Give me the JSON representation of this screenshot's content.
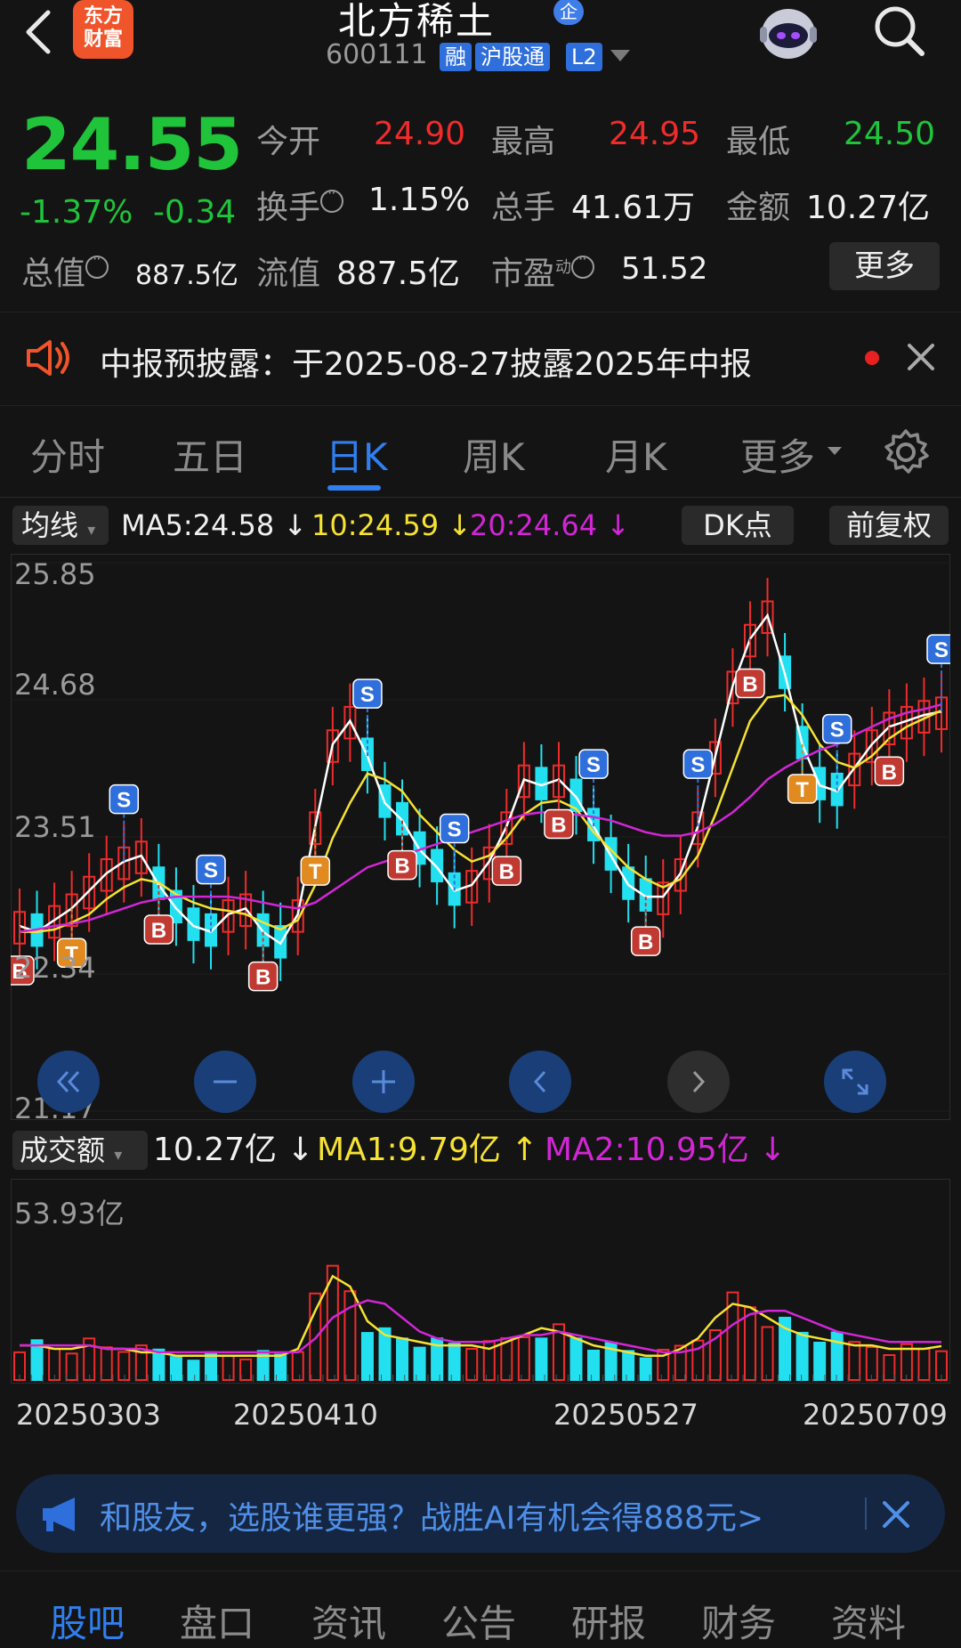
{
  "header": {
    "logo_line1": "东方",
    "logo_line2": "财富",
    "stock_name": "北方稀土",
    "enterprise_badge": "企",
    "code": "600111",
    "tags": [
      "融",
      "沪股通",
      "L2"
    ]
  },
  "quote": {
    "price": "24.55",
    "change_pct": "-1.37%",
    "change_amt": "-0.34",
    "open_label": "今开",
    "open_value": "24.90",
    "high_label": "最高",
    "high_value": "24.95",
    "low_label": "最低",
    "low_value": "24.50",
    "turnover_label": "换手",
    "turnover_value": "1.15%",
    "volume_label": "总手",
    "volume_value": "41.61万",
    "amount_label": "金额",
    "amount_value": "10.27亿",
    "total_cap_label": "总值",
    "total_cap_value": "887.5亿",
    "float_cap_label": "流值",
    "float_cap_value": "887.5亿",
    "pe_label": "市盈",
    "pe_sup": "动",
    "pe_value": "51.52",
    "more_label": "更多"
  },
  "notice": {
    "text": "中报预披露：于2025-08-27披露2025年中报"
  },
  "tabs": {
    "items": [
      "分时",
      "五日",
      "日K",
      "周K",
      "月K",
      "更多"
    ],
    "active_index": 2
  },
  "indicator": {
    "selector": "均线",
    "ma5": "MA5:24.58",
    "ma10": "10:24.59",
    "ma20": "20:24.64",
    "dk_label": "DK点",
    "adjust_label": "前复权"
  },
  "volume_indicator": {
    "selector": "成交额",
    "value": "10.27亿",
    "ma1": "MA1:9.79亿",
    "ma2": "MA2:10.95亿"
  },
  "colors": {
    "up": "#f02b2b",
    "down": "#1fc43a",
    "candle_down": "#22e0f0",
    "ma5": "#ffffff",
    "ma10": "#f5e233",
    "ma20": "#d226d6",
    "accent": "#2f7ff0"
  },
  "chart_data": {
    "type": "candlestick",
    "y_axis_ticks": [
      "25.85",
      "24.68",
      "23.51",
      "22.34",
      "21.17"
    ],
    "ylim": [
      21.17,
      25.85
    ],
    "x_labels": [
      "20250303",
      "20250410",
      "20250527",
      "20250709"
    ],
    "volume_ylabel": "53.93亿",
    "series": [
      {
        "name": "MA5",
        "values": [
          22.75,
          22.7,
          22.8,
          22.9,
          23.05,
          23.2,
          23.3,
          23.35,
          23.1,
          22.9,
          22.75,
          22.7,
          22.85,
          22.9,
          22.7,
          22.6,
          22.85,
          23.6,
          24.3,
          24.5,
          24.2,
          23.8,
          23.65,
          23.4,
          23.25,
          23.05,
          23.1,
          23.3,
          23.6,
          24.0,
          23.95,
          24.0,
          23.85,
          23.6,
          23.35,
          23.1,
          23.0,
          23.0,
          23.2,
          23.6,
          24.2,
          24.8,
          25.2,
          25.4,
          24.9,
          24.3,
          23.95,
          23.9,
          24.1,
          24.3,
          24.45,
          24.5,
          24.55,
          24.58
        ]
      },
      {
        "name": "MA10",
        "values": [
          22.7,
          22.7,
          22.72,
          22.78,
          22.85,
          22.98,
          23.08,
          23.15,
          23.12,
          23.02,
          22.95,
          22.9,
          22.88,
          22.85,
          22.78,
          22.72,
          22.8,
          23.1,
          23.5,
          23.8,
          24.05,
          24.0,
          23.9,
          23.7,
          23.55,
          23.4,
          23.3,
          23.35,
          23.5,
          23.7,
          23.8,
          23.82,
          23.75,
          23.55,
          23.4,
          23.25,
          23.15,
          23.08,
          23.15,
          23.35,
          23.7,
          24.1,
          24.5,
          24.7,
          24.72,
          24.55,
          24.3,
          24.15,
          24.1,
          24.2,
          24.35,
          24.45,
          24.52,
          24.59
        ]
      },
      {
        "name": "MA20",
        "values": [
          22.7,
          22.72,
          22.75,
          22.77,
          22.8,
          22.85,
          22.9,
          22.95,
          22.98,
          23.0,
          23.0,
          23.0,
          23.0,
          22.98,
          22.95,
          22.92,
          22.9,
          22.95,
          23.05,
          23.15,
          23.25,
          23.3,
          23.35,
          23.4,
          23.45,
          23.5,
          23.55,
          23.6,
          23.65,
          23.7,
          23.72,
          23.72,
          23.7,
          23.68,
          23.65,
          23.6,
          23.55,
          23.52,
          23.52,
          23.55,
          23.62,
          23.72,
          23.85,
          24.0,
          24.1,
          24.18,
          24.25,
          24.3,
          24.38,
          24.45,
          24.52,
          24.57,
          24.6,
          24.64
        ]
      }
    ],
    "volume_ma": [
      {
        "name": "MA1",
        "values": [
          10,
          10,
          9,
          9,
          10,
          9,
          9,
          8,
          8,
          7,
          7,
          7,
          7,
          7,
          7,
          7,
          9,
          20,
          30,
          27,
          17,
          13,
          12,
          11,
          10,
          10,
          10,
          9,
          11,
          13,
          15,
          14,
          12,
          10,
          9,
          8,
          7,
          7,
          9,
          12,
          18,
          22,
          21,
          18,
          15,
          13,
          12,
          11,
          10,
          10,
          9,
          9,
          9,
          9.79
        ]
      },
      {
        "name": "MA2",
        "values": [
          10,
          10,
          10,
          10,
          10,
          9,
          9,
          9,
          8,
          8,
          8,
          8,
          8,
          8,
          8,
          8,
          8,
          12,
          18,
          21,
          23,
          22,
          18,
          14,
          12,
          11,
          11,
          11,
          12,
          13,
          13,
          14,
          13,
          12,
          11,
          10,
          9,
          8,
          8,
          9,
          12,
          16,
          19,
          20,
          20,
          18,
          16,
          14,
          13,
          12,
          11,
          11,
          11,
          10.95
        ]
      }
    ],
    "signals": [
      {
        "type": "B"
      },
      {
        "type": "T"
      },
      {
        "type": "S"
      },
      {
        "type": "B"
      },
      {
        "type": "S"
      },
      {
        "type": "B"
      },
      {
        "type": "T"
      },
      {
        "type": "S"
      },
      {
        "type": "B"
      },
      {
        "type": "S"
      },
      {
        "type": "B"
      },
      {
        "type": "B"
      },
      {
        "type": "S"
      },
      {
        "type": "B"
      },
      {
        "type": "S"
      },
      {
        "type": "B"
      },
      {
        "type": "T"
      },
      {
        "type": "S"
      },
      {
        "type": "B"
      },
      {
        "type": "S"
      }
    ]
  },
  "ad": {
    "text": "和股友，选股谁更强？战胜AI有机会得888元>"
  },
  "bottom_nav": {
    "items": [
      "股吧",
      "盘口",
      "资讯",
      "公告",
      "研报",
      "财务",
      "资料"
    ],
    "active_index": 0
  }
}
